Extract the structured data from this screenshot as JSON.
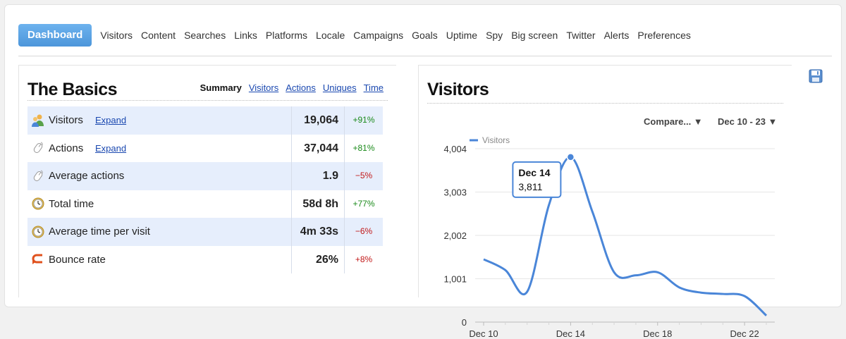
{
  "nav": {
    "active": "Dashboard",
    "links": [
      "Visitors",
      "Content",
      "Searches",
      "Links",
      "Platforms",
      "Locale",
      "Campaigns",
      "Goals",
      "Uptime",
      "Spy",
      "Big screen",
      "Twitter",
      "Alerts",
      "Preferences"
    ]
  },
  "basics": {
    "title": "The Basics",
    "tabs": {
      "active": "Summary",
      "links": [
        "Visitors",
        "Actions",
        "Uniques",
        "Time"
      ]
    },
    "rows": [
      {
        "icon": "visitors-icon",
        "label": "Visitors",
        "expand": "Expand",
        "value": "19,064",
        "change": "+91%",
        "trend": "pos"
      },
      {
        "icon": "mouse-icon",
        "label": "Actions",
        "expand": "Expand",
        "value": "37,044",
        "change": "+81%",
        "trend": "pos"
      },
      {
        "icon": "mouse-icon",
        "label": "Average actions",
        "expand": "",
        "value": "1.9",
        "change": "−5%",
        "trend": "neg"
      },
      {
        "icon": "clock-icon",
        "label": "Total time",
        "expand": "",
        "value": "58d 8h",
        "change": "+77%",
        "trend": "pos"
      },
      {
        "icon": "clock-icon",
        "label": "Average time per visit",
        "expand": "",
        "value": "4m 33s",
        "change": "−6%",
        "trend": "neg"
      },
      {
        "icon": "bounce-icon",
        "label": "Bounce rate",
        "expand": "",
        "value": "26%",
        "change": "+8%",
        "trend": "neg"
      }
    ]
  },
  "visitors_panel": {
    "title": "Visitors",
    "compare_label": "Compare... ▼",
    "range_label": "Dec 10 - 23 ▼",
    "tooltip": {
      "date": "Dec 14",
      "value": "3,811"
    }
  },
  "colors": {
    "accent": "#5aa4e6",
    "line": "#4a86d8",
    "positive": "#1a8a1a",
    "negative": "#c21818",
    "row_shade": "#e6eefc"
  },
  "chart_data": {
    "type": "line",
    "series": [
      {
        "name": "Visitors",
        "x": [
          "Dec 10",
          "Dec 11",
          "Dec 12",
          "Dec 13",
          "Dec 14",
          "Dec 15",
          "Dec 16",
          "Dec 17",
          "Dec 18",
          "Dec 19",
          "Dec 20",
          "Dec 21",
          "Dec 22",
          "Dec 23"
        ],
        "values": [
          1450,
          1200,
          700,
          2700,
          3811,
          2550,
          1150,
          1080,
          1150,
          800,
          680,
          650,
          600,
          150
        ]
      }
    ],
    "y_ticks": [
      "0",
      "1,001",
      "2,002",
      "3,003",
      "4,004"
    ],
    "x_ticks": [
      "Dec 10",
      "Dec 14",
      "Dec 18",
      "Dec 22"
    ],
    "ylim": [
      0,
      4004
    ],
    "grid": true,
    "legend": "top-left"
  }
}
